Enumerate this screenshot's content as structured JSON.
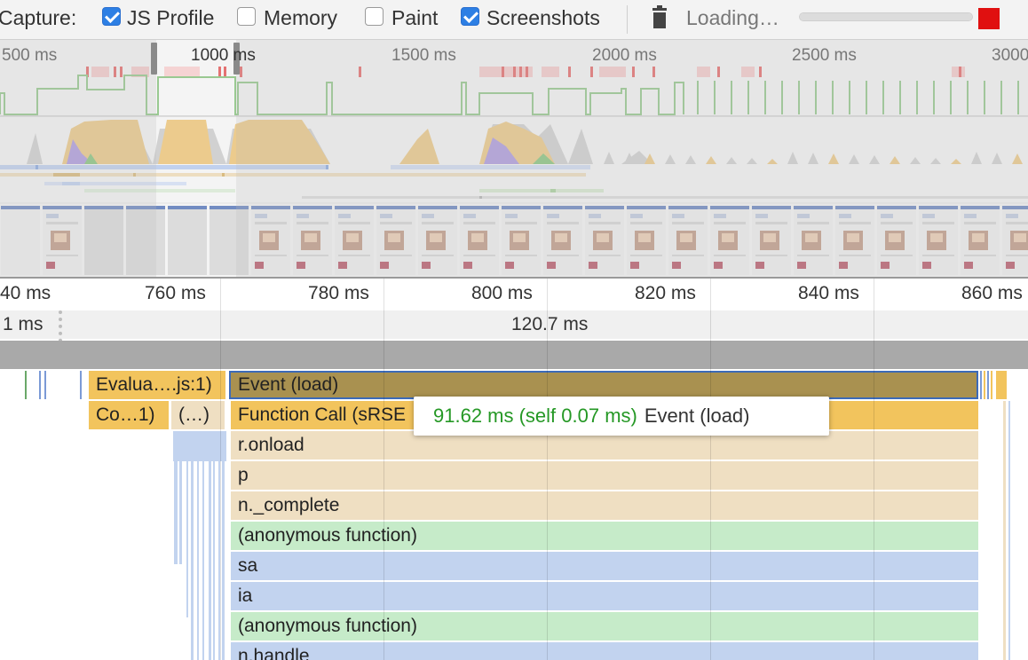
{
  "toolbar": {
    "capture_label": "Capture:",
    "js_profile_label": "JS Profile",
    "js_profile_checked": true,
    "memory_label": "Memory",
    "memory_checked": false,
    "paint_label": "Paint",
    "paint_checked": false,
    "screenshots_label": "Screenshots",
    "screenshots_checked": true,
    "loading_text": "Loading…",
    "stop_color": "#e01010"
  },
  "overview": {
    "ticks": [
      "500 ms",
      "1000 ms",
      "1500 ms",
      "2000 ms",
      "2500 ms",
      "3000"
    ]
  },
  "main_ruler": {
    "ticks": [
      "40 ms",
      "760 ms",
      "780 ms",
      "800 ms",
      "820 ms",
      "840 ms",
      "860 ms"
    ]
  },
  "frames": {
    "left_label": "1 ms",
    "center_label": "120.7 ms"
  },
  "flame": {
    "row0": {
      "evaluate": "Evalua….js:1)",
      "event": "Event (load)"
    },
    "row1": {
      "compile": "Co…1)",
      "paren": "(…)",
      "function_call": "Function Call (sRSE"
    },
    "stack": [
      "r.onload",
      "p",
      "n._complete",
      "(anonymous function)",
      "sa",
      "ia",
      "(anonymous function)",
      "n.handle"
    ],
    "colors": {
      "event": "#a99150",
      "scripting": "#f2c45d",
      "tan": "#efdfc2",
      "green": "#c6ebc9",
      "blue": "#c2d3ef"
    }
  },
  "tooltip": {
    "duration": "91.62 ms (self 0.07 ms)",
    "name": "Event (load)"
  }
}
